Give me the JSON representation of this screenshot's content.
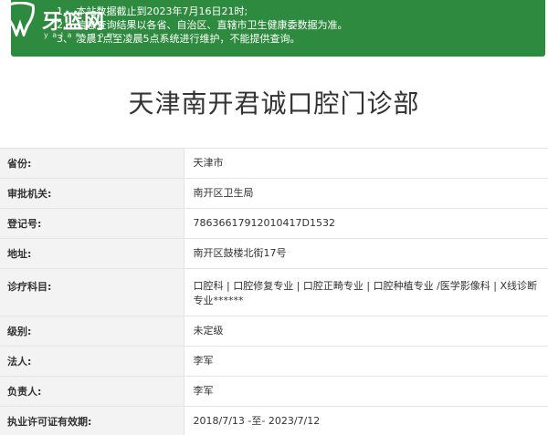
{
  "brand": {
    "name": "牙篮网",
    "url": "y a l a n . c o m"
  },
  "notice": {
    "lines": [
      "1、 本站数据截止到2023年7月16日21时;",
      "2、 信息查询结果以各省、自治区、直辖市卫生健康委数据为准。",
      "3、 凌晨1点至凌晨5点系统进行维护，不能提供查询。"
    ]
  },
  "title": "天津南开君诚口腔门诊部",
  "rows": [
    {
      "label": "省份:",
      "value": "天津市"
    },
    {
      "label": "审批机关:",
      "value": "南开区卫生局"
    },
    {
      "label": "登记号:",
      "value": "78636617912010417D1532"
    },
    {
      "label": "地址:",
      "value": "南开区鼓楼北街17号"
    },
    {
      "label": "诊疗科目:",
      "value": "口腔科 | 口腔修复专业 | 口腔正畸专业 | 口腔种植专业 /医学影像科 | X线诊断专业******"
    },
    {
      "label": "级别:",
      "value": "未定级"
    },
    {
      "label": "法人:",
      "value": "李军"
    },
    {
      "label": "负责人:",
      "value": "李军"
    },
    {
      "label": "执业许可证有效期:",
      "value": "2018/7/13 -至- 2023/7/12"
    }
  ],
  "colors": {
    "notice_bg": "#2d8a3e",
    "label_bg": "#f3f3f3"
  }
}
